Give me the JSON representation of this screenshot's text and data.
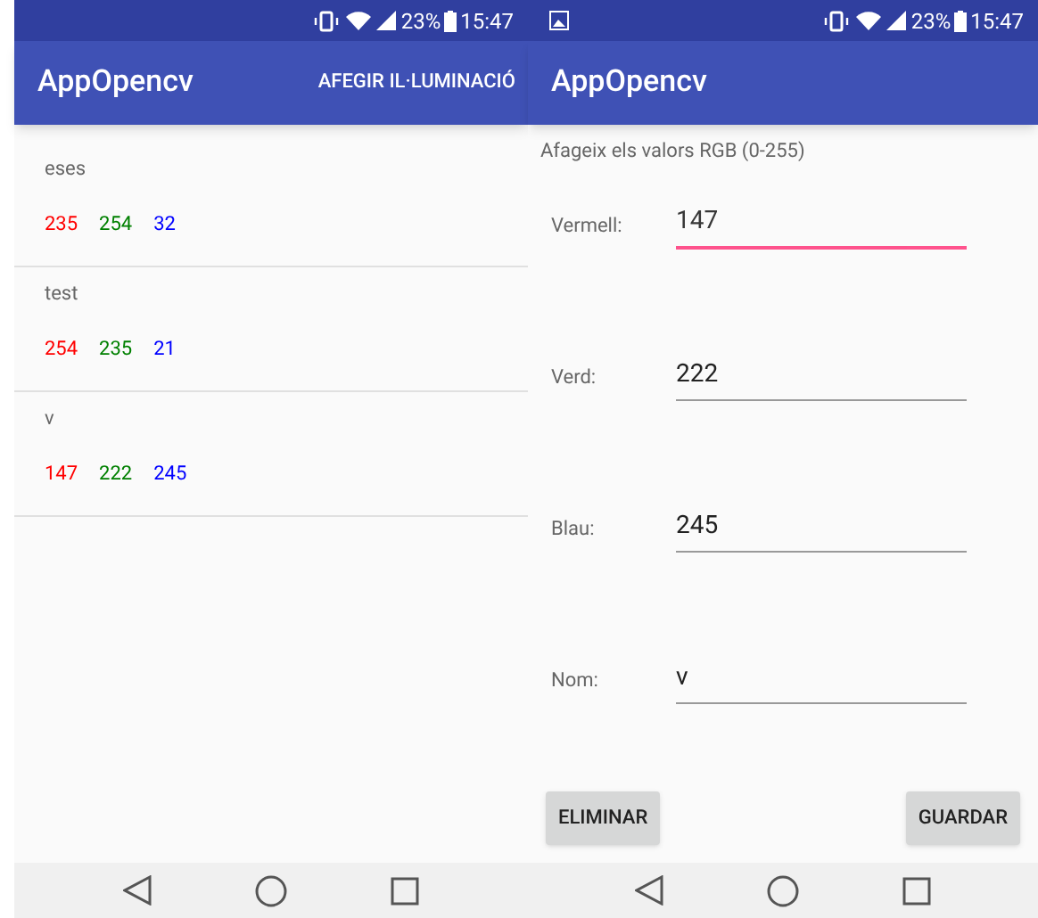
{
  "screens": [
    {
      "status_bar": {
        "gallery_notification": false,
        "battery": "23%",
        "time": "15:47"
      },
      "app_bar": {
        "title": "AppOpencv",
        "action": "AFEGIR IL·LUMINACIÓ"
      },
      "list": [
        {
          "name": "eses",
          "values": [
            {
              "text": "235",
              "color": "#ff0000"
            },
            {
              "text": "254",
              "color": "#008000"
            },
            {
              "text": "32",
              "color": "#0000ff"
            }
          ]
        },
        {
          "name": "test",
          "values": [
            {
              "text": "254",
              "color": "#ff0000"
            },
            {
              "text": "235",
              "color": "#008000"
            },
            {
              "text": "21",
              "color": "#0000ff"
            }
          ]
        },
        {
          "name": "v",
          "values": [
            {
              "text": "147",
              "color": "#ff0000"
            },
            {
              "text": "222",
              "color": "#008000"
            },
            {
              "text": "245",
              "color": "#0000ff"
            }
          ]
        }
      ]
    },
    {
      "status_bar": {
        "gallery_notification": true,
        "battery": "23%",
        "time": "15:47"
      },
      "app_bar": {
        "title": "AppOpencv"
      },
      "instruction": "Afageix els valors RGB (0-255)",
      "fields": [
        {
          "label": "Vermell:",
          "value": "147",
          "focused": true
        },
        {
          "label": "Verd:",
          "value": "222",
          "focused": false
        },
        {
          "label": "Blau:",
          "value": "245",
          "focused": false
        },
        {
          "label": "Nom:",
          "value": "v",
          "focused": false
        }
      ],
      "buttons": [
        "ELIMINAR",
        "GUARDAR"
      ]
    }
  ]
}
